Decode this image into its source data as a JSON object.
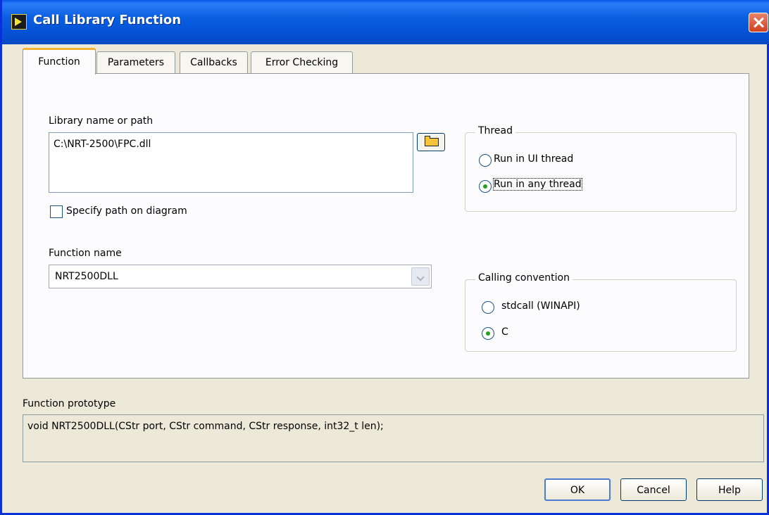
{
  "window": {
    "title": "Call Library Function",
    "icon": "labview-icon"
  },
  "tabs": [
    {
      "label": "Function",
      "active": true
    },
    {
      "label": "Parameters",
      "active": false
    },
    {
      "label": "Callbacks",
      "active": false
    },
    {
      "label": "Error Checking",
      "active": false
    }
  ],
  "library": {
    "label": "Library name or path",
    "value": "C:\\NRT-2500\\FPC.dll",
    "browse_icon": "folder-open-icon"
  },
  "specify_path": {
    "label": "Specify path on diagram",
    "checked": false
  },
  "function_name": {
    "label": "Function name",
    "value": "NRT2500DLL"
  },
  "thread": {
    "legend": "Thread",
    "options": [
      {
        "label": "Run in UI thread",
        "selected": false
      },
      {
        "label": "Run in any thread",
        "selected": true
      }
    ]
  },
  "calling_convention": {
    "legend": "Calling convention",
    "options": [
      {
        "label": "stdcall (WINAPI)",
        "selected": false
      },
      {
        "label": "C",
        "selected": true
      }
    ]
  },
  "prototype": {
    "label": "Function prototype",
    "value": "void  NRT2500DLL(CStr port, CStr command, CStr response, int32_t len);"
  },
  "buttons": {
    "ok": "OK",
    "cancel": "Cancel",
    "help": "Help"
  },
  "colors": {
    "titlebar": "#0a5fe0",
    "tab_highlight": "#f8b232",
    "radio_dot": "#21a121"
  }
}
